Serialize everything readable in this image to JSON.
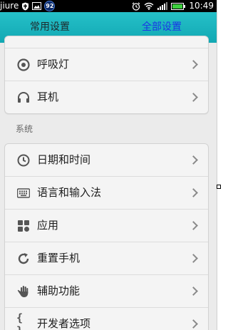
{
  "status_bar": {
    "carrier": "jiure",
    "notification_badge": "92",
    "time": "10:49",
    "icons": [
      "shield-icon",
      "image-icon",
      "notification-badge-icon",
      "alarm-icon",
      "wifi-icon",
      "signal-icon",
      "battery-icon"
    ]
  },
  "tabs": [
    {
      "label": "常用设置",
      "active": false
    },
    {
      "label": "全部设置",
      "active": true
    }
  ],
  "colors": {
    "tab_bar": "#12a8b3",
    "active_tab_text": "#1a35e6",
    "inactive_tab_text": "#1d2b2e"
  },
  "group1": {
    "items": [
      {
        "label": "呼吸灯",
        "icon": "breathing-light-icon"
      },
      {
        "label": "耳机",
        "icon": "headphones-icon"
      }
    ]
  },
  "section_system": {
    "header": "系统",
    "items": [
      {
        "label": "日期和时间",
        "icon": "clock-icon"
      },
      {
        "label": "语言和输入法",
        "icon": "keyboard-icon"
      },
      {
        "label": "应用",
        "icon": "apps-icon"
      },
      {
        "label": "重置手机",
        "icon": "reset-icon"
      },
      {
        "label": "辅助功能",
        "icon": "hand-icon"
      },
      {
        "label": "开发者选项",
        "icon": "braces-icon"
      }
    ]
  }
}
